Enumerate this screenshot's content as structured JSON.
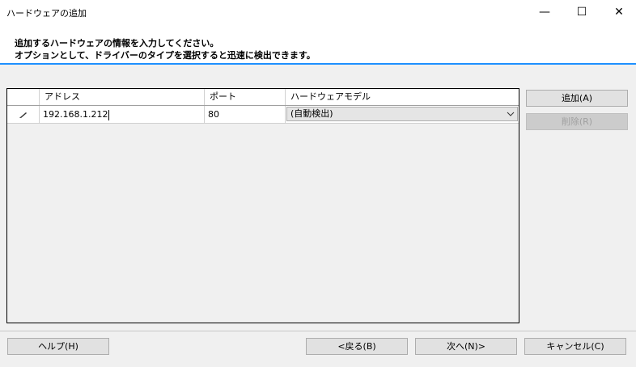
{
  "window": {
    "title": "ハードウェアの追加",
    "minimize": "—",
    "maximize": "☐",
    "close": "✕"
  },
  "header": {
    "line1": "追加するハードウェアの情報を入力してください。",
    "line2": "オプションとして、ドライバーのタイプを選択すると迅速に検出できます。"
  },
  "grid": {
    "columns": [
      "アドレス",
      "ポート",
      "ハードウェアモデル"
    ],
    "rows": [
      {
        "address": "192.168.1.212",
        "port": "80",
        "model": "(自動検出)"
      }
    ]
  },
  "side_buttons": {
    "add": "追加(A)",
    "delete": "削除(R)"
  },
  "footer": {
    "help": "ヘルプ(H)",
    "back": "<戻る(B)",
    "next": "次へ(N)>",
    "cancel": "キャンセル(C)"
  }
}
